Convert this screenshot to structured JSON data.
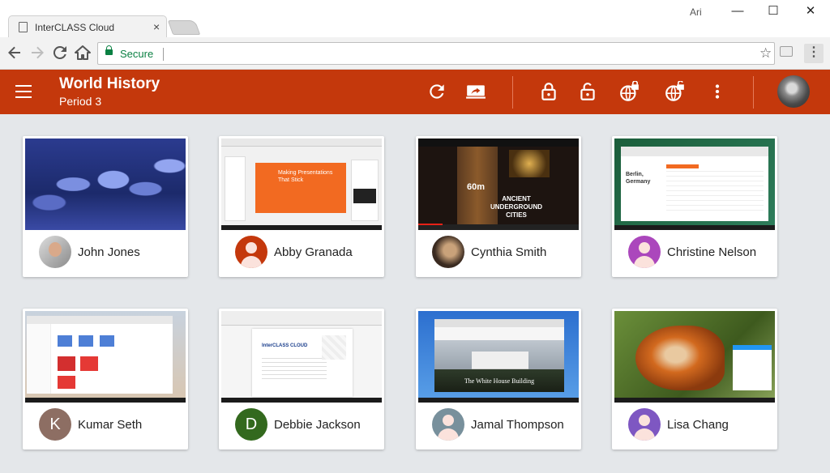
{
  "browser": {
    "tab_title": "InterCLASS Cloud",
    "tab_close": "×",
    "user": "Ari",
    "secure_label": "Secure",
    "window_controls": {
      "minimize": "—",
      "maximize": "☐",
      "close": "✕"
    },
    "icons": [
      "back-icon",
      "forward-icon",
      "reload-icon",
      "home-icon",
      "lock-icon",
      "star-icon",
      "extension-icon",
      "menu-icon"
    ]
  },
  "header": {
    "title": "World History",
    "subtitle": "Period 3",
    "color": "#c4380c",
    "icons": [
      "refresh-icon",
      "share-screen-icon",
      "lock-icon",
      "unlock-icon",
      "web-lock-icon",
      "web-unlock-icon",
      "more-vert-icon"
    ]
  },
  "students": [
    {
      "name": "John Jones",
      "avatar": "photo",
      "thumbnail": "fungi-wallpaper"
    },
    {
      "name": "Abby Granada",
      "avatar": "person-icon",
      "avatar_color": "#c4380c",
      "thumbnail": "presentation"
    },
    {
      "name": "Cynthia Smith",
      "avatar": "photo",
      "thumbnail": "video"
    },
    {
      "name": "Christine Nelson",
      "avatar": "person-icon",
      "avatar_color": "#ab47bc",
      "thumbnail": "spreadsheet"
    },
    {
      "name": "Kumar Seth",
      "avatar": "K",
      "avatar_color": "#8d6e63",
      "thumbnail": "drive"
    },
    {
      "name": "Debbie Jackson",
      "avatar": "D",
      "avatar_color": "#33691e",
      "thumbnail": "document"
    },
    {
      "name": "Jamal Thompson",
      "avatar": "person-icon",
      "avatar_color": "#78909c",
      "thumbnail": "website"
    },
    {
      "name": "Lisa Chang",
      "avatar": "person-icon",
      "avatar_color": "#7e57c2",
      "thumbnail": "fox-wallpaper"
    }
  ],
  "thumb_text": {
    "slide_title": "Making Presentations That Stick",
    "video_depth": "60m",
    "video_title": "ANCIENT UNDERGROUND CITIES",
    "sheet_city": "Berlin, Germany",
    "doc_title": "InterCLASS CLOUD",
    "site_caption": "The White House Building"
  }
}
